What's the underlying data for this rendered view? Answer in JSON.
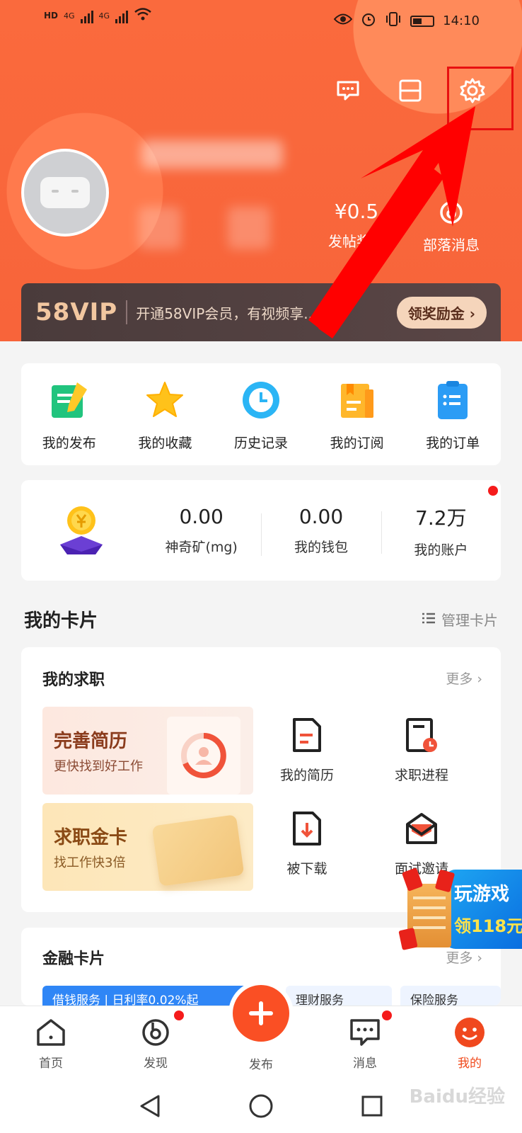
{
  "status_bar": {
    "left_labels": [
      "HD",
      "4G",
      "4G"
    ],
    "battery": "28",
    "time": "14:10"
  },
  "header": {
    "vip_name_hidden": true,
    "reward": {
      "value": "¥0.5",
      "label": "发帖奖励"
    },
    "tribe": {
      "label": "部落消息"
    }
  },
  "vip_banner": {
    "logo": "58VIP",
    "text": "开通58VIP会员，有视频享...",
    "button": "领奖励金 ›"
  },
  "quick_actions": [
    {
      "label": "我的发布",
      "icon": "publish-doc-icon"
    },
    {
      "label": "我的收藏",
      "icon": "star-icon"
    },
    {
      "label": "历史记录",
      "icon": "clock-icon"
    },
    {
      "label": "我的订阅",
      "icon": "subscribe-icon"
    },
    {
      "label": "我的订单",
      "icon": "order-icon"
    }
  ],
  "wallet": {
    "stats": [
      {
        "value": "0.00",
        "label": "神奇矿(mg)"
      },
      {
        "value": "0.00",
        "label": "我的钱包"
      },
      {
        "value": "7.2万",
        "label": "我的账户"
      }
    ]
  },
  "cards_section": {
    "title": "我的卡片",
    "manage": "管理卡片"
  },
  "job_card": {
    "title": "我的求职",
    "more": "更多 ›",
    "promo1": {
      "title": "完善简历",
      "subtitle": "更快找到好工作"
    },
    "promo2": {
      "title": "求职金卡",
      "subtitle": "找工作快3倍"
    },
    "items": [
      {
        "label": "我的简历",
        "icon": "resume-icon"
      },
      {
        "label": "求职进程",
        "icon": "progress-icon"
      },
      {
        "label": "被下载",
        "icon": "download-icon"
      },
      {
        "label": "面试邀请",
        "icon": "invite-icon"
      }
    ]
  },
  "finance_card": {
    "title": "金融卡片",
    "more": "更多 ›",
    "tabs": [
      "借钱服务 | 日利率0.02%起",
      "理财服务",
      "保险服务"
    ]
  },
  "game_float": {
    "line1": "玩游戏",
    "line2": "领118元"
  },
  "bottom_nav": [
    {
      "label": "首页",
      "icon": "home-icon",
      "active": false
    },
    {
      "label": "发现",
      "icon": "discover-icon",
      "active": false
    },
    {
      "label": "发布",
      "icon": "plus-icon",
      "active": false
    },
    {
      "label": "消息",
      "icon": "message-icon",
      "active": false
    },
    {
      "label": "我的",
      "icon": "smile-icon",
      "active": true
    }
  ],
  "watermark": "Baidu经验",
  "colors": {
    "accent": "#fa4f24",
    "header": "#f8643a",
    "annotation": "#e81010"
  }
}
